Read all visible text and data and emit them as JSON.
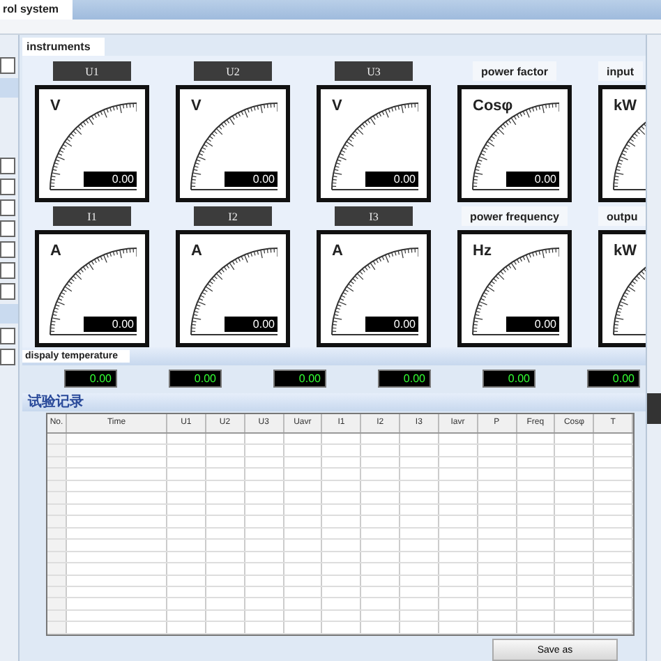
{
  "window": {
    "title": "rol system"
  },
  "instruments": {
    "title": "instruments",
    "rows": [
      [
        {
          "kind": "dark",
          "header": "U1",
          "unit": "V",
          "reading": "0.00"
        },
        {
          "kind": "dark",
          "header": "U2",
          "unit": "V",
          "reading": "0.00"
        },
        {
          "kind": "dark",
          "header": "U3",
          "unit": "V",
          "reading": "0.00"
        },
        {
          "kind": "plain",
          "header": "power factor",
          "unit": "Cosφ",
          "reading": "0.00"
        },
        {
          "kind": "plain",
          "header": "input",
          "unit": "kW"
        }
      ],
      [
        {
          "kind": "dark",
          "header": "I1",
          "unit": "A",
          "reading": "0.00"
        },
        {
          "kind": "dark",
          "header": "I2",
          "unit": "A",
          "reading": "0.00"
        },
        {
          "kind": "dark",
          "header": "I3",
          "unit": "A",
          "reading": "0.00"
        },
        {
          "kind": "plain",
          "header": "power frequency",
          "unit": "Hz",
          "reading": "0.00"
        },
        {
          "kind": "plain",
          "header": "outpu",
          "unit": "kW"
        }
      ]
    ]
  },
  "temperature": {
    "title": "dispaly temperature",
    "readings": [
      "0.00",
      "0.00",
      "0.00",
      "0.00",
      "0.00",
      "0.00"
    ]
  },
  "record": {
    "title": "试验记录",
    "columns": [
      "No.",
      "Time",
      "U1",
      "U2",
      "U3",
      "Uavr",
      "I1",
      "I2",
      "I3",
      "Iavr",
      "P",
      "Freq",
      "Cosφ",
      "T"
    ]
  },
  "buttons": {
    "save": "Save as"
  }
}
